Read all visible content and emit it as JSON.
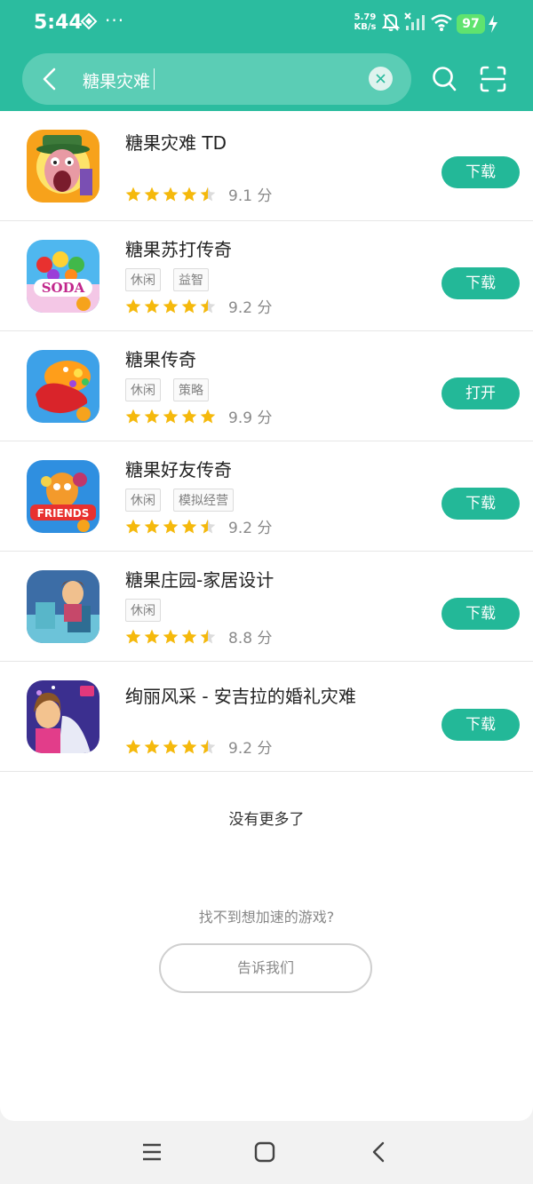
{
  "status_bar": {
    "time": "5:44",
    "net_speed_value": "5.79",
    "net_speed_unit": "KB/s",
    "battery": "97"
  },
  "search": {
    "query": "糖果灾难"
  },
  "results": [
    {
      "title": "糖果灾难 TD",
      "tags": [],
      "rating": 4.5,
      "score_text": "9.1 分",
      "button": "下载"
    },
    {
      "title": "糖果苏打传奇",
      "tags": [
        "休闲",
        "益智"
      ],
      "rating": 4.5,
      "score_text": "9.2 分",
      "button": "下载"
    },
    {
      "title": "糖果传奇",
      "tags": [
        "休闲",
        "策略"
      ],
      "rating": 5,
      "score_text": "9.9 分",
      "button": "打开"
    },
    {
      "title": "糖果好友传奇",
      "tags": [
        "休闲",
        "模拟经营"
      ],
      "rating": 4.5,
      "score_text": "9.2 分",
      "button": "下载"
    },
    {
      "title": "糖果庄园-家居设计",
      "tags": [
        "休闲"
      ],
      "rating": 4.5,
      "score_text": "8.8 分",
      "button": "下载"
    },
    {
      "title": "绚丽风采 - 安吉拉的婚礼灾难",
      "tags": [],
      "rating": 4.5,
      "score_text": "9.2 分",
      "button": "下载"
    }
  ],
  "footer": {
    "no_more": "没有更多了",
    "cant_find": "找不到想加速的游戏?",
    "tell_us": "告诉我们"
  },
  "colors": {
    "brand": "#2bbc9f",
    "button": "#23b898",
    "star": "#f5b90c"
  },
  "icons": {
    "back": "chevron-left-icon",
    "clear": "close-circle-icon",
    "search": "search-icon",
    "scan": "scan-icon",
    "nav_menu": "menu-icon",
    "nav_home": "home-square-icon",
    "nav_back": "back-icon"
  }
}
